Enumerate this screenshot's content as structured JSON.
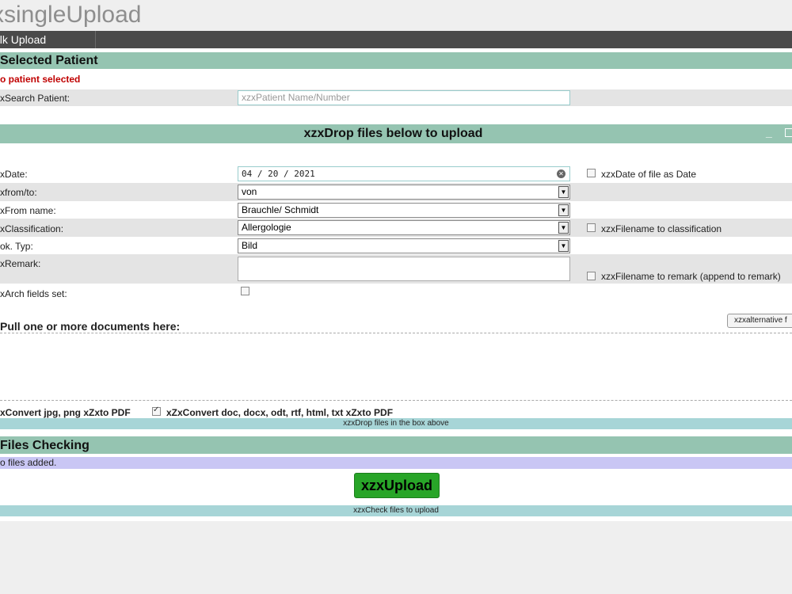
{
  "page": {
    "title": "xsingleUpload"
  },
  "tabs": [
    {
      "label": "ulk Upload"
    }
  ],
  "selected_patient": {
    "header": "Selected Patient",
    "status": "o patient selected",
    "search_label": "xSearch Patient:",
    "search_placeholder": "xzxPatient Name/Number",
    "status_color": "#c00000"
  },
  "drop_panel": {
    "header": "xzxDrop files below to upload",
    "minimize_icon": "minimize-icon",
    "maximize_icon": "maximize-icon",
    "fields": {
      "date_label": "xDate:",
      "date_value": "04 / 20 / 2021",
      "date_clear_icon": "clear-icon",
      "fromto_label": "xfrom/to:",
      "fromto_value": "von",
      "fromname_label": "xFrom name:",
      "fromname_value": "Brauchle/ Schmidt",
      "classification_label": "xClassification:",
      "classification_value": "Allergologie",
      "doktyp_label": "ok. Typ:",
      "doktyp_value": "Bild",
      "remark_label": "xRemark:",
      "remark_value": "",
      "arch_label": "xArch fields set:"
    },
    "options": {
      "date_as_date": "xzxDate of file as Date",
      "filename_classification": "xzxFilename to classification",
      "filename_remark": "xzxFilename to remark (append to remark)"
    },
    "pull_label": "Pull one or more documents here:",
    "alt_button": "xzxalternative f",
    "convert_img": "xConvert jpg, png xZxto PDF",
    "convert_doc": "xZxConvert doc, docx, odt, rtf, html, txt xZxto PDF",
    "drop_info": "xzxDrop files in the box above"
  },
  "files_checking": {
    "header": "Files Checking",
    "status": "o files added.",
    "upload_button": "xzxUpload",
    "check_info": "xzxCheck files to upload",
    "upload_color": "#28a528"
  }
}
